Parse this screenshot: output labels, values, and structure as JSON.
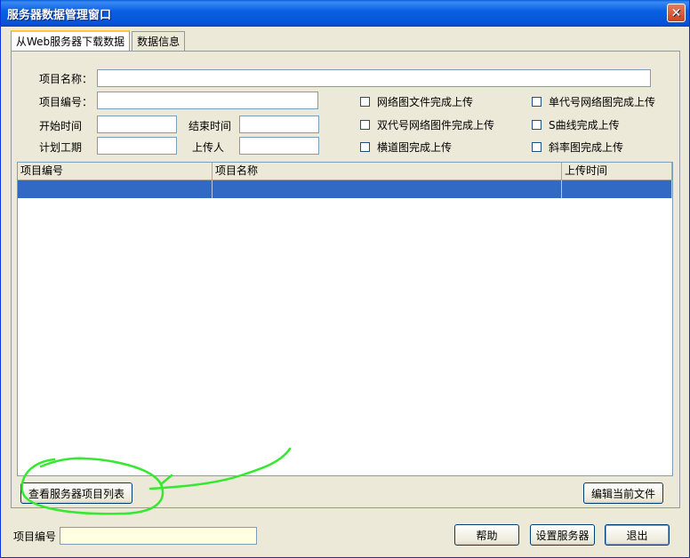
{
  "window": {
    "title": "服务器数据管理窗口",
    "close_label": "✕"
  },
  "tabs": [
    {
      "label": "从Web服务器下载数据",
      "active": true
    },
    {
      "label": "数据信息",
      "active": false
    }
  ],
  "form": {
    "project_name_label": "项目名称：",
    "project_name_value": "",
    "project_code_label": "项目编号：",
    "project_code_value": "",
    "start_time_label": "开始时间",
    "start_time_value": "",
    "end_time_label": "结束时间",
    "end_time_value": "",
    "plan_duration_label": "计划工期",
    "plan_duration_value": "",
    "uploader_label": "上传人",
    "uploader_value": ""
  },
  "checkboxes": [
    {
      "label": "网络图文件完成上传",
      "checked": false
    },
    {
      "label": "单代号网络图完成上传",
      "checked": false
    },
    {
      "label": "双代号网络图件完成上传",
      "checked": false
    },
    {
      "label": "S曲线完成上传",
      "checked": false
    },
    {
      "label": "横道图完成上传",
      "checked": false
    },
    {
      "label": "斜率图完成上传",
      "checked": false
    }
  ],
  "table": {
    "columns": [
      "项目编号",
      "项目名称",
      "上传时间"
    ],
    "rows": [
      [
        "",
        "",
        ""
      ]
    ]
  },
  "buttons": {
    "list_projects": "查看服务器项目列表",
    "edit_file": "编辑当前文件",
    "help": "帮助",
    "set_server": "设置服务器",
    "exit": "退出"
  },
  "footer": {
    "project_code_label": "项目编号",
    "project_code_value": ""
  },
  "colors": {
    "selection": "#316ac5",
    "annotation": "#35e830",
    "titlebar": "#0553d6"
  }
}
